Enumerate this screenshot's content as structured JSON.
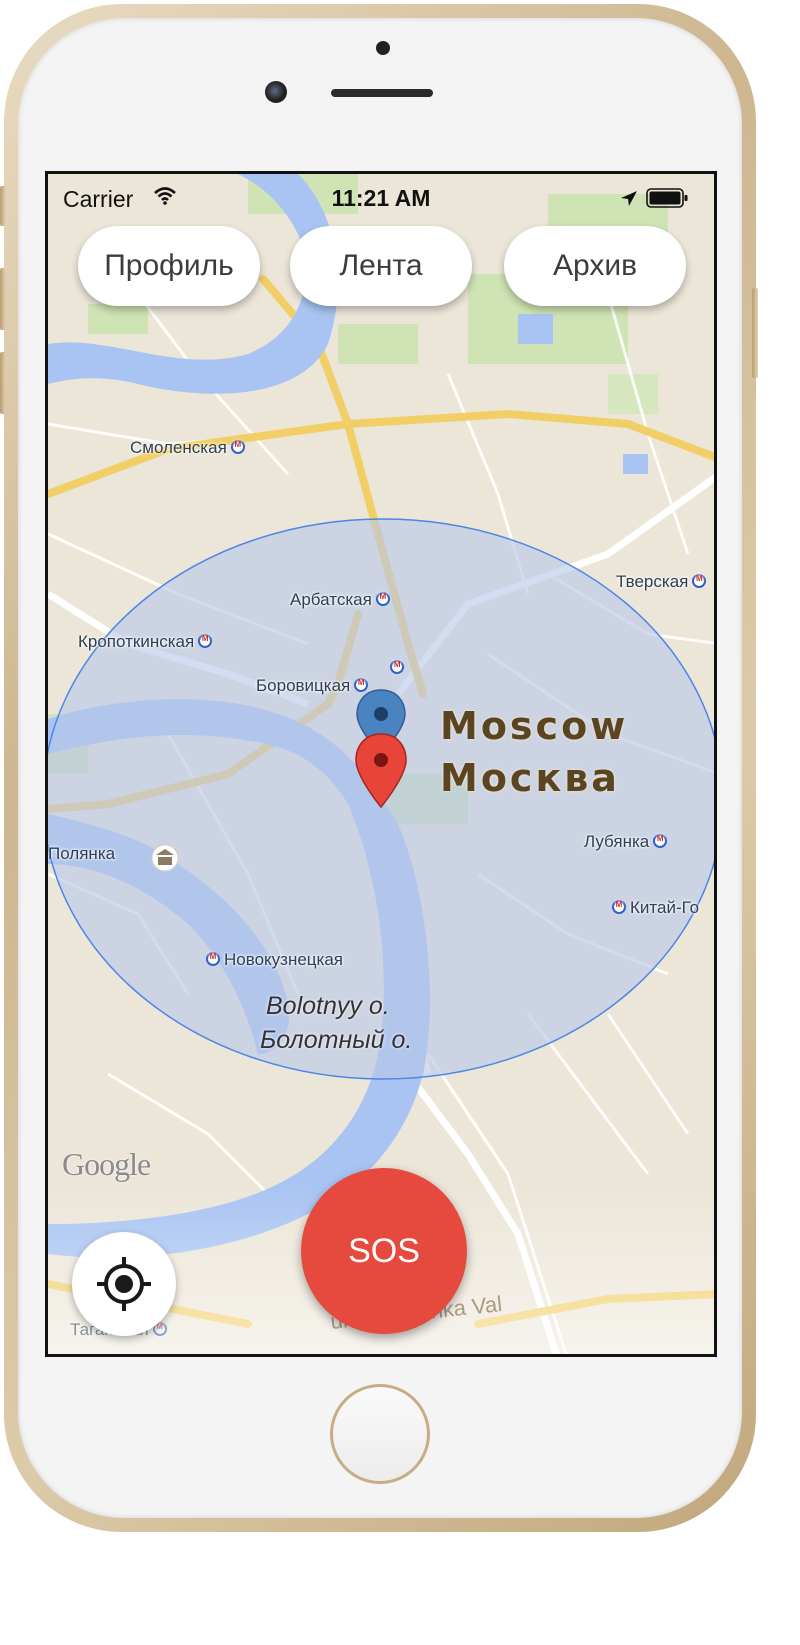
{
  "status_bar": {
    "carrier": "Carrier",
    "time": "11:21 AM",
    "icons": [
      "wifi-icon",
      "location-arrow-icon",
      "battery-icon"
    ]
  },
  "top_nav": {
    "profile_label": "Профиль",
    "feed_label": "Лента",
    "archive_label": "Архив"
  },
  "map": {
    "city_name_en": "Moscow",
    "city_name_ru": "Москва",
    "island_name_en": "Bolotnyy o.",
    "island_name_ru": "Болотный о.",
    "street_label": "ul. Yakimanka Val",
    "attribution": "Google",
    "stations": {
      "smolenskaya": "Смоленская",
      "tverskaya": "Тверская",
      "arbatskaya": "Арбатская",
      "kropotkinskaya": "Кропоткинская",
      "borovitskaya": "Боровицкая",
      "lubyanka": "Лубянка",
      "kitay_gorod": "Китай-Го",
      "polyanka": "Полянка",
      "novokuznetskaya": "Новокузнецкая",
      "taganskaya": "Таганская"
    },
    "markers": [
      "current-location-pin",
      "alert-pin"
    ]
  },
  "actions": {
    "sos_label": "SOS",
    "locate_icon": "crosshair-icon"
  },
  "colors": {
    "sos": "#e64a3f",
    "radius_fill": "#b8c6e8",
    "radius_stroke": "#4a86e8",
    "blue_pin": "#4a84c0",
    "red_pin": "#e8443a",
    "river": "#a9c4f2",
    "major_road": "#f6d36a"
  }
}
